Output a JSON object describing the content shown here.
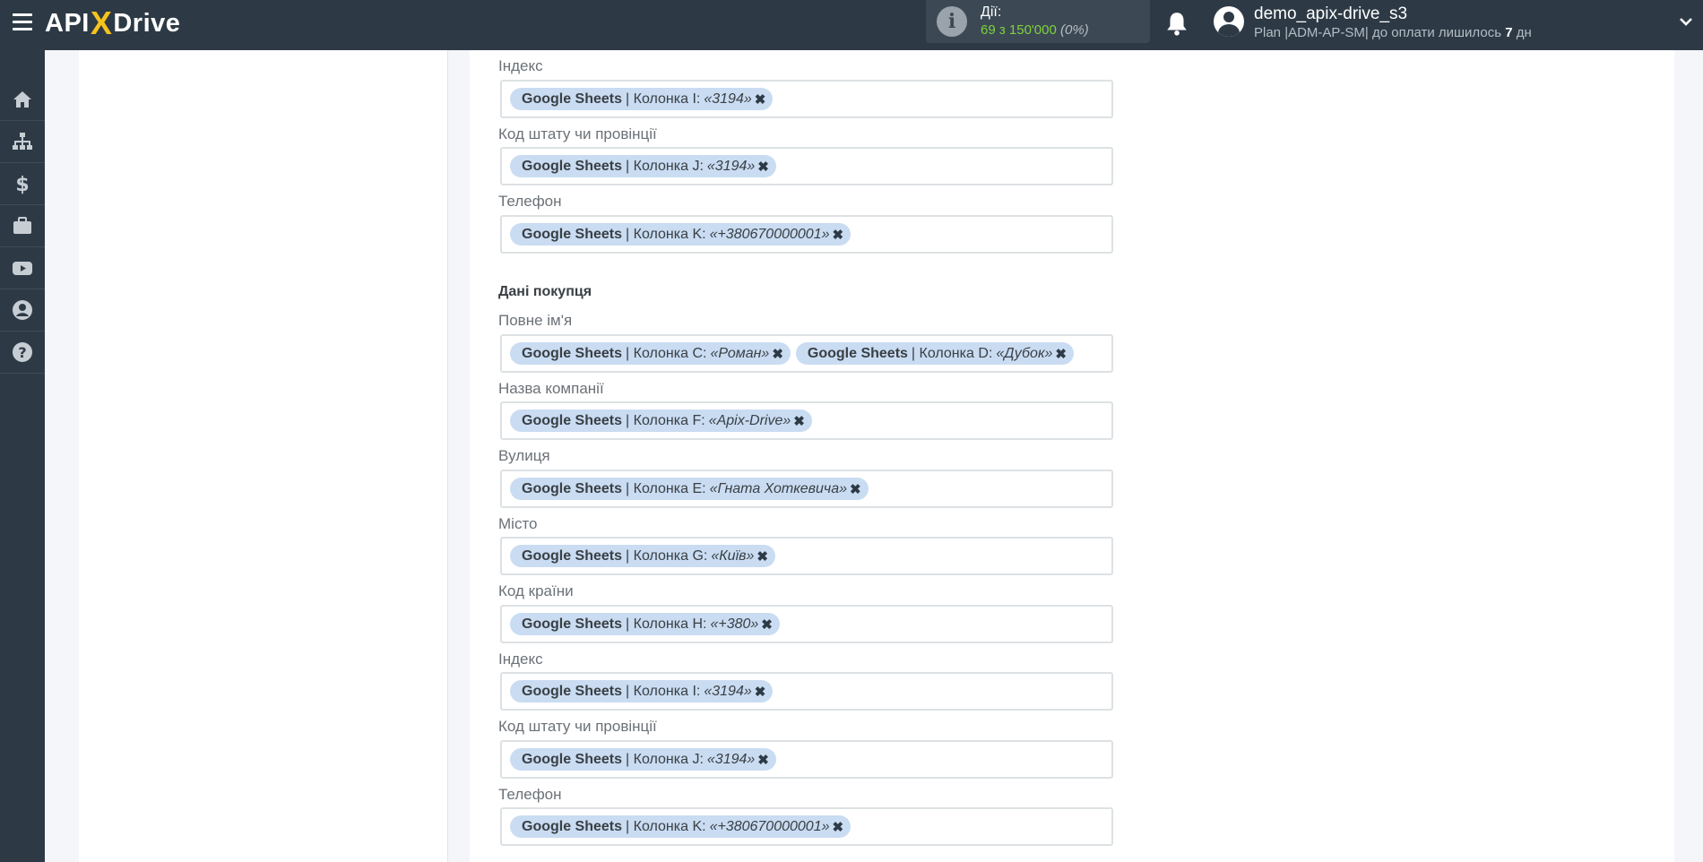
{
  "header": {
    "logo_api": "API",
    "logo_x": "X",
    "logo_drive": "Drive",
    "actions_label": "Дії:",
    "actions_count": "69 з 150'000",
    "actions_pct": "(0%)",
    "user_name": "demo_apix-drive_s3",
    "plan_prefix": "Plan |ADM-AP-SM| до оплати лишилось ",
    "plan_days": "7",
    "plan_suffix": " дн"
  },
  "sidebar": {
    "items": [
      "home-icon",
      "sitemap-icon",
      "dollar-icon",
      "briefcase-icon",
      "youtube-icon",
      "user-circle-icon",
      "question-icon"
    ]
  },
  "form": {
    "top_fields": [
      {
        "label": "Індекс",
        "tags": [
          {
            "source": "Google Sheets",
            "column": "| Колонка I:",
            "value": "«3194»"
          }
        ]
      },
      {
        "label": "Код штату чи провінції",
        "tags": [
          {
            "source": "Google Sheets",
            "column": "| Колонка J:",
            "value": "«3194»"
          }
        ]
      },
      {
        "label": "Телефон",
        "tags": [
          {
            "source": "Google Sheets",
            "column": "| Колонка K:",
            "value": "«+380670000001»"
          }
        ]
      }
    ],
    "section_title": "Дані покупця",
    "buyer_fields": [
      {
        "label": "Повне ім'я",
        "tags": [
          {
            "source": "Google Sheets",
            "column": "| Колонка C:",
            "value": "«Роман»"
          },
          {
            "source": "Google Sheets",
            "column": "| Колонка D:",
            "value": "«Дубок»"
          }
        ]
      },
      {
        "label": "Назва компанії",
        "tags": [
          {
            "source": "Google Sheets",
            "column": "| Колонка F:",
            "value": "«Apix-Drive»"
          }
        ]
      },
      {
        "label": "Вулиця",
        "tags": [
          {
            "source": "Google Sheets",
            "column": "| Колонка E:",
            "value": "«Гната Хоткевича»"
          }
        ]
      },
      {
        "label": "Місто",
        "tags": [
          {
            "source": "Google Sheets",
            "column": "| Колонка G:",
            "value": "«Київ»"
          }
        ]
      },
      {
        "label": "Код країни",
        "tags": [
          {
            "source": "Google Sheets",
            "column": "| Колонка H:",
            "value": "«+380»"
          }
        ]
      },
      {
        "label": "Індекс",
        "tags": [
          {
            "source": "Google Sheets",
            "column": "| Колонка I:",
            "value": "«3194»"
          }
        ]
      },
      {
        "label": "Код штату чи провінції",
        "tags": [
          {
            "source": "Google Sheets",
            "column": "| Колонка J:",
            "value": "«3194»"
          }
        ]
      },
      {
        "label": "Телефон",
        "tags": [
          {
            "source": "Google Sheets",
            "column": "| Колонка K:",
            "value": "«+380670000001»"
          }
        ]
      }
    ],
    "remove_symbol": "✖"
  }
}
